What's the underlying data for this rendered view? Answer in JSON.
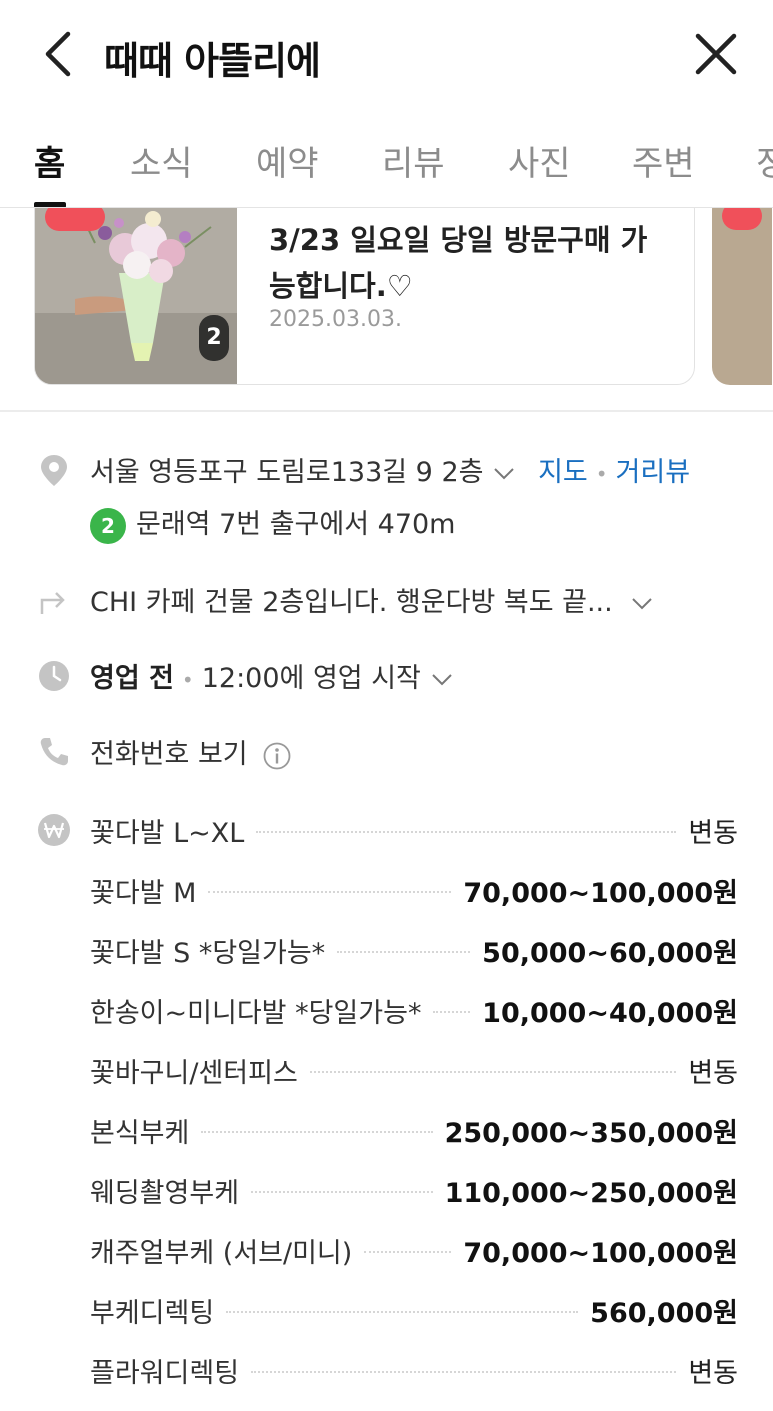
{
  "header": {
    "title": "때때 아뜰리에"
  },
  "tabs": [
    {
      "label": "홈"
    },
    {
      "label": "소식"
    },
    {
      "label": "예약"
    },
    {
      "label": "리뷰"
    },
    {
      "label": "사진"
    },
    {
      "label": "주변"
    },
    {
      "label": "정"
    }
  ],
  "news": {
    "title": "3/23 일요일 당일 방문구매 가능합니다.♡",
    "date": "2025.03.03.",
    "image_count": "2"
  },
  "info": {
    "address": "서울 영등포구 도림로133길 9 2층",
    "map_link": "지도",
    "street_view_link": "거리뷰",
    "subway_line": "2",
    "subway_text": "문래역 7번 출구에서 470m",
    "directions": "CHI 카페 건물 2층입니다. 행운다방 복도 끝...",
    "status": "영업 전",
    "hours": "12:00에 영업 시작",
    "phone": "전화번호 보기"
  },
  "prices": [
    {
      "name": "꽃다발 L~XL",
      "value": "변동"
    },
    {
      "name": "꽃다발 M",
      "value": "70,000~100,000원"
    },
    {
      "name": "꽃다발 S *당일가능*",
      "value": "50,000~60,000원"
    },
    {
      "name": "한송이~미니다발 *당일가능*",
      "value": "10,000~40,000원"
    },
    {
      "name": "꽃바구니/센터피스",
      "value": "변동"
    },
    {
      "name": "본식부케",
      "value": "250,000~350,000원"
    },
    {
      "name": "웨딩촬영부케",
      "value": "110,000~250,000원"
    },
    {
      "name": "캐주얼부케 (서브/미니)",
      "value": "70,000~100,000원"
    },
    {
      "name": "부케디렉팅",
      "value": "560,000원"
    },
    {
      "name": "플라워디렉팅",
      "value": "변동"
    }
  ],
  "icons": {
    "back": "back-arrow-icon",
    "close": "close-icon",
    "location": "location-pin-icon",
    "directions": "directions-arrow-icon",
    "clock": "clock-icon",
    "phone": "phone-icon",
    "price": "won-icon",
    "info": "info-icon"
  },
  "colors": {
    "link": "#1a6fc0",
    "subway_line_2": "#3ab54a",
    "badge": "#f0505a"
  }
}
